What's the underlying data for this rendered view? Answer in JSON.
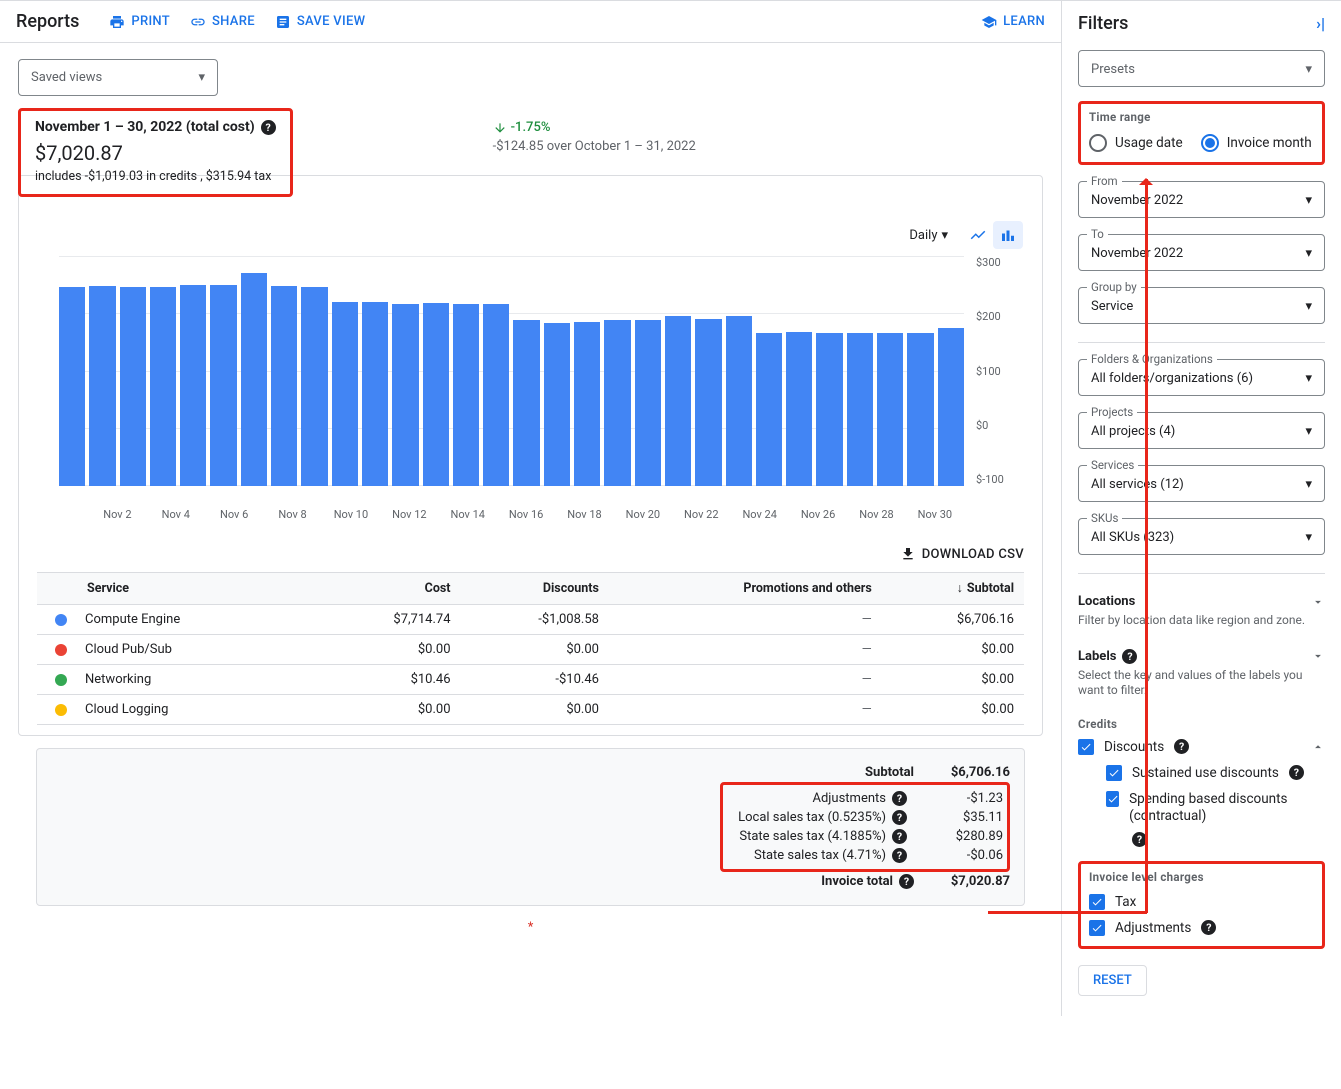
{
  "header": {
    "title": "Reports",
    "print": "PRINT",
    "share": "SHARE",
    "save_view": "SAVE VIEW",
    "learn": "LEARN"
  },
  "saved_views": {
    "label": "Saved views"
  },
  "summary": {
    "title": "November 1 – 30, 2022 (total cost)",
    "amount": "$7,020.87",
    "sub": "includes -$1,019.03 in credits , $315.94 tax",
    "trend_pct": "-1.75%",
    "trend_sub": "-$124.85 over October 1 – 31, 2022"
  },
  "chart_controls": {
    "period": "Daily"
  },
  "download_csv": "DOWNLOAD CSV",
  "table": {
    "headers": {
      "service": "Service",
      "cost": "Cost",
      "discounts": "Discounts",
      "promotions": "Promotions and others",
      "subtotal": "Subtotal"
    },
    "rows": [
      {
        "color": "#4285f4",
        "service": "Compute Engine",
        "cost": "$7,714.74",
        "discounts": "-$1,008.58",
        "promotions": "—",
        "subtotal": "$6,706.16"
      },
      {
        "color": "#ea4335",
        "service": "Cloud Pub/Sub",
        "cost": "$0.00",
        "discounts": "$0.00",
        "promotions": "—",
        "subtotal": "$0.00"
      },
      {
        "color": "#34a853",
        "service": "Networking",
        "cost": "$10.46",
        "discounts": "-$10.46",
        "promotions": "—",
        "subtotal": "$0.00"
      },
      {
        "color": "#fbbc04",
        "service": "Cloud Logging",
        "cost": "$0.00",
        "discounts": "$0.00",
        "promotions": "—",
        "subtotal": "$0.00"
      }
    ]
  },
  "totals": {
    "subtotal_label": "Subtotal",
    "subtotal": "$6,706.16",
    "adjustments_label": "Adjustments",
    "adjustments": "-$1.23",
    "local_tax_label": "Local sales tax (0.5235%)",
    "local_tax": "$35.11",
    "state_tax1_label": "State sales tax (4.1885%)",
    "state_tax1": "$280.89",
    "state_tax2_label": "State sales tax (4.71%)",
    "state_tax2": "-$0.06",
    "invoice_total_label": "Invoice total",
    "invoice_total": "$7,020.87"
  },
  "asterisk": "*",
  "filters": {
    "title": "Filters",
    "presets": "Presets",
    "time_range_label": "Time range",
    "usage_date": "Usage date",
    "invoice_month": "Invoice month",
    "from_label": "From",
    "from_value": "November 2022",
    "to_label": "To",
    "to_value": "November 2022",
    "group_by_label": "Group by",
    "group_by_value": "Service",
    "folders_label": "Folders & Organizations",
    "folders_value": "All folders/organizations (6)",
    "projects_label": "Projects",
    "projects_value": "All projects (4)",
    "services_label": "Services",
    "services_value": "All services (12)",
    "skus_label": "SKUs",
    "skus_value": "All SKUs (323)",
    "locations_label": "Locations",
    "locations_sub": "Filter by location data like region and zone.",
    "labels_label": "Labels",
    "labels_sub": "Select the key and values of the labels you want to filter.",
    "credits_label": "Credits",
    "discounts_label": "Discounts",
    "sustained_label": "Sustained use discounts",
    "spending_label": "Spending based discounts (contractual)",
    "ilc_label": "Invoice level charges",
    "tax_label": "Tax",
    "adjustments_label": "Adjustments",
    "reset": "RESET"
  },
  "chart_data": {
    "type": "bar",
    "title": "",
    "xlabel": "",
    "ylabel": "",
    "ylim": [
      -100,
      300
    ],
    "y_ticks": [
      "$300",
      "$200",
      "$100",
      "$0",
      "$-100"
    ],
    "x_categories": [
      "Nov 1",
      "Nov 2",
      "Nov 3",
      "Nov 4",
      "Nov 5",
      "Nov 6",
      "Nov 7",
      "Nov 8",
      "Nov 9",
      "Nov 10",
      "Nov 11",
      "Nov 12",
      "Nov 13",
      "Nov 14",
      "Nov 15",
      "Nov 16",
      "Nov 17",
      "Nov 18",
      "Nov 19",
      "Nov 20",
      "Nov 21",
      "Nov 22",
      "Nov 23",
      "Nov 24",
      "Nov 25",
      "Nov 26",
      "Nov 27",
      "Nov 28",
      "Nov 29",
      "Nov 30"
    ],
    "x_ticks_shown": [
      "Nov 2",
      "Nov 4",
      "Nov 6",
      "Nov 8",
      "Nov 10",
      "Nov 12",
      "Nov 14",
      "Nov 16",
      "Nov 18",
      "Nov 20",
      "Nov 22",
      "Nov 24",
      "Nov 26",
      "Nov 28",
      "Nov 30"
    ],
    "series": [
      {
        "name": "Cost",
        "color": "#4285f4",
        "values": [
          260,
          261,
          260,
          260,
          262,
          262,
          278,
          261,
          259,
          240,
          240,
          238,
          239,
          238,
          238,
          216,
          212,
          214,
          216,
          216,
          222,
          218,
          222,
          200,
          201,
          200,
          200,
          199,
          199,
          206
        ]
      }
    ]
  }
}
